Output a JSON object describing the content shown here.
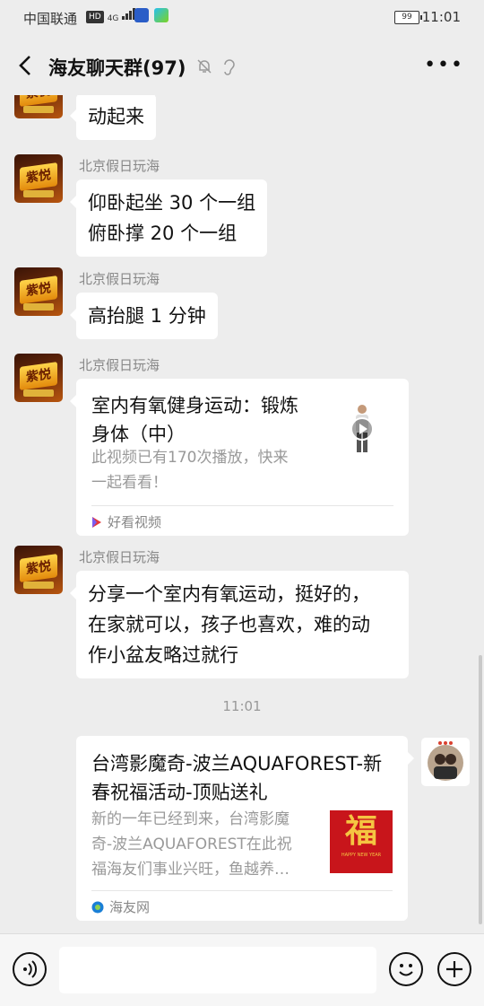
{
  "status_bar": {
    "carrier": "中国联通",
    "network": "HD",
    "signal": "4G",
    "battery": "99",
    "time": "11:01"
  },
  "header": {
    "title": "海友聊天群(97)"
  },
  "messages": [
    {
      "sender": "",
      "text": "动起来"
    },
    {
      "sender": "北京假日玩海",
      "lines": [
        "仰卧起坐 30 个一组",
        "俯卧撑 20 个一组"
      ]
    },
    {
      "sender": "北京假日玩海",
      "text": "高抬腿 1 分钟"
    },
    {
      "sender": "北京假日玩海",
      "card": {
        "title_lines": [
          "室内有氧健身运动：锻炼",
          "身体（中）"
        ],
        "desc_lines": [
          "此视频已有170次播放，快来",
          "一起看看！"
        ],
        "source": "好看视频"
      }
    },
    {
      "sender": "北京假日玩海",
      "lines": [
        "分享一个室内有氧运动，挺好的，",
        "在家就可以，孩子也喜欢，难的动",
        "作小盆友略过就行"
      ]
    }
  ],
  "timestamp": "11:01",
  "outgoing_card": {
    "title_lines": [
      "台湾影魔奇-波兰AQUAFOREST-新",
      "春祝福活动-顶贴送礼"
    ],
    "desc_lines": [
      "新的一年已经到来，台湾影魔",
      "奇-波兰AQUAFOREST在此祝",
      "福海友们事业兴旺，鱼越养…"
    ],
    "thumb_char": "福",
    "thumb_caption": "HAPPY NEW YEAR",
    "source": "海友网"
  },
  "avatar_logo_text": "紫悦",
  "colors": {
    "background": "#ededed",
    "bubble": "#ffffff",
    "thumb_red": "#c8151b"
  },
  "icons": [
    "back-icon",
    "mute-bell-icon",
    "ear-icon",
    "more-icon",
    "play-icon",
    "haokan-icon",
    "haiyou-icon",
    "voice-icon",
    "emoji-icon",
    "plus-icon"
  ]
}
